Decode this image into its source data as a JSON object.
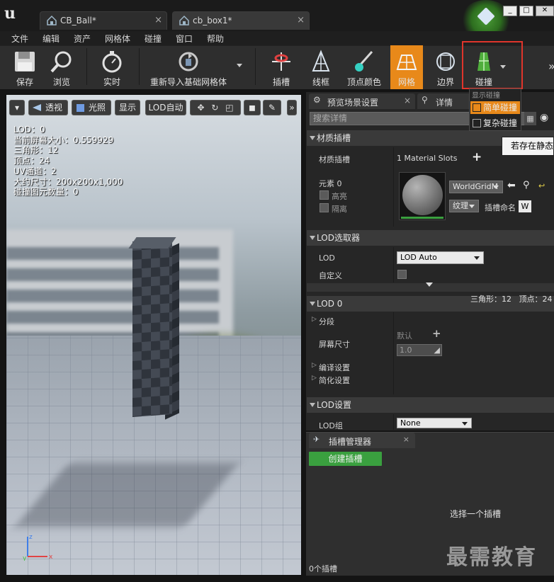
{
  "window": {
    "tabs": [
      {
        "label": "CB_Ball*",
        "close": "×"
      },
      {
        "label": "cb_box1*",
        "close": "×"
      }
    ],
    "controls": {
      "minimize": "_",
      "maximize": "□",
      "close": "✕"
    }
  },
  "menu": [
    "文件",
    "编辑",
    "资产",
    "网格体",
    "碰撞",
    "窗口",
    "帮助"
  ],
  "toolbar": {
    "save": "保存",
    "browse": "浏览",
    "realtime": "实时",
    "reimport": "重新导入基础网格体",
    "socket": "插槽",
    "wireframe": "线框",
    "vertex_color": "顶点颜色",
    "mesh": "网格",
    "bounds": "边界",
    "collision": "碰撞",
    "overflow": "»"
  },
  "collision_menu": {
    "header": "显示碰撞",
    "items": [
      {
        "label": "简单碰撞",
        "checked": true
      },
      {
        "label": "复杂碰撞",
        "checked": false
      }
    ]
  },
  "tooltip": "若存在静态网格体",
  "viewport": {
    "buttons": {
      "menu": "▾",
      "perspective": "透视",
      "lit": "光照",
      "show": "显示",
      "lod": "LOD自动",
      "more": "»"
    },
    "info": [
      "LOD：0",
      "当前屏幕大小：0.559929",
      "三角形：12",
      "顶点：24",
      "UV通道：2",
      "大约尺寸：200x200x1,000",
      "碰撞图元数量：0"
    ],
    "axes": {
      "x": "x",
      "y": "y",
      "z": "z"
    }
  },
  "details": {
    "tabs": [
      {
        "label": "预览场景设置",
        "close": "×"
      },
      {
        "label": "详情",
        "close": "×"
      }
    ],
    "search_placeholder": "搜索详情",
    "material_section": {
      "title": "材质插槽",
      "label": "材质插槽",
      "slots_text": "1 Material Slots",
      "add": "+",
      "element": "元素 0",
      "highlight": "高亮",
      "isolate": "隔离",
      "material_name": "WorldGridM",
      "texture": "纹理",
      "slot_name_label": "插槽命名",
      "slot_name_value": "W"
    },
    "lod_picker": {
      "title": "LOD选取器",
      "lod_label": "LOD",
      "lod_value": "LOD Auto",
      "custom_label": "自定义"
    },
    "lod0": {
      "title": "LOD 0",
      "stats": "三角形：12   顶点：24",
      "sections": "分段",
      "screen_size": "屏幕尺寸",
      "default": "默认",
      "add": "+",
      "screen_size_value": "1.0",
      "build_settings": "编译设置",
      "reduction_settings": "简化设置"
    },
    "lod_settings": {
      "title": "LOD设置",
      "lod_group_label": "LOD组",
      "lod_group_value": "None"
    }
  },
  "socket_manager": {
    "tab": "插槽管理器",
    "close": "×",
    "create_button": "创建插槽",
    "empty_text": "选择一个插槽",
    "count": "0个插槽"
  },
  "watermark": "最需教育",
  "colors": {
    "accent_orange": "#e8891a",
    "highlight_red": "#e0352b",
    "create_green": "#3aa03f"
  }
}
